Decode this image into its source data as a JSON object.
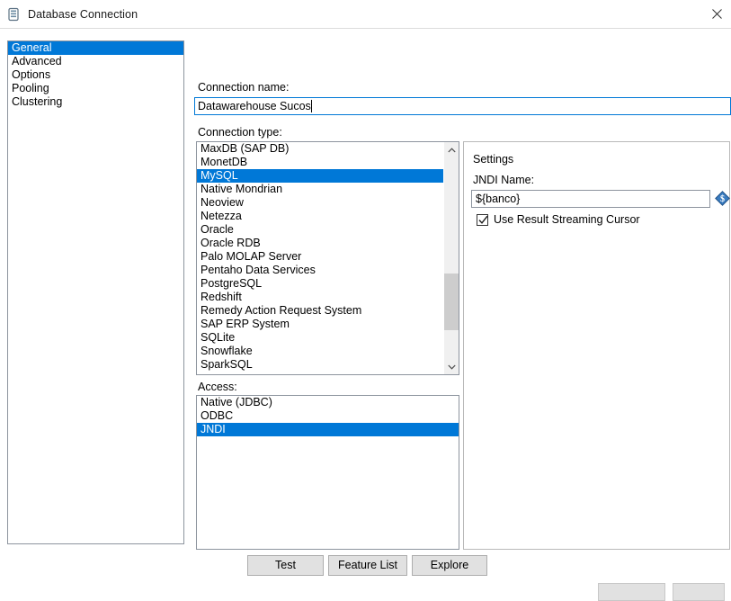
{
  "window": {
    "title": "Database Connection",
    "icon": "database-icon",
    "close_label": "Close"
  },
  "colors": {
    "selection": "#0078D7",
    "button_face": "#E1E1E1",
    "border": "#8D949E",
    "variable_icon": "#2E72B8"
  },
  "sidebar": {
    "items": [
      {
        "label": "General",
        "selected": true
      },
      {
        "label": "Advanced",
        "selected": false
      },
      {
        "label": "Options",
        "selected": false
      },
      {
        "label": "Pooling",
        "selected": false
      },
      {
        "label": "Clustering",
        "selected": false
      }
    ]
  },
  "general": {
    "connection_name": {
      "label": "Connection name:",
      "value": "Datawarehouse Sucos",
      "placeholder": ""
    },
    "connection_type": {
      "label": "Connection type:",
      "selected": "MySQL",
      "items": [
        {
          "label": "MaxDB (SAP DB)",
          "selected": false
        },
        {
          "label": "MonetDB",
          "selected": false
        },
        {
          "label": "MySQL",
          "selected": true
        },
        {
          "label": "Native Mondrian",
          "selected": false
        },
        {
          "label": "Neoview",
          "selected": false
        },
        {
          "label": "Netezza",
          "selected": false
        },
        {
          "label": "Oracle",
          "selected": false
        },
        {
          "label": "Oracle RDB",
          "selected": false
        },
        {
          "label": "Palo MOLAP Server",
          "selected": false
        },
        {
          "label": "Pentaho Data Services",
          "selected": false
        },
        {
          "label": "PostgreSQL",
          "selected": false
        },
        {
          "label": "Redshift",
          "selected": false
        },
        {
          "label": "Remedy Action Request System",
          "selected": false
        },
        {
          "label": "SAP ERP System",
          "selected": false
        },
        {
          "label": "SQLite",
          "selected": false
        },
        {
          "label": "Snowflake",
          "selected": false
        },
        {
          "label": "SparkSQL",
          "selected": false
        }
      ]
    },
    "access": {
      "label": "Access:",
      "selected": "JNDI",
      "items": [
        {
          "label": "Native (JDBC)",
          "selected": false
        },
        {
          "label": "ODBC",
          "selected": false
        },
        {
          "label": "JNDI",
          "selected": true
        }
      ]
    }
  },
  "settings": {
    "title": "Settings",
    "jndi_name": {
      "label": "JNDI Name:",
      "value": "${banco}",
      "placeholder": ""
    },
    "variable_icon": "variable-dollar-icon",
    "streaming_cursor": {
      "label": "Use Result Streaming Cursor",
      "checked": true
    }
  },
  "buttons": {
    "test": "Test",
    "feature_list": "Feature List",
    "explore": "Explore"
  }
}
